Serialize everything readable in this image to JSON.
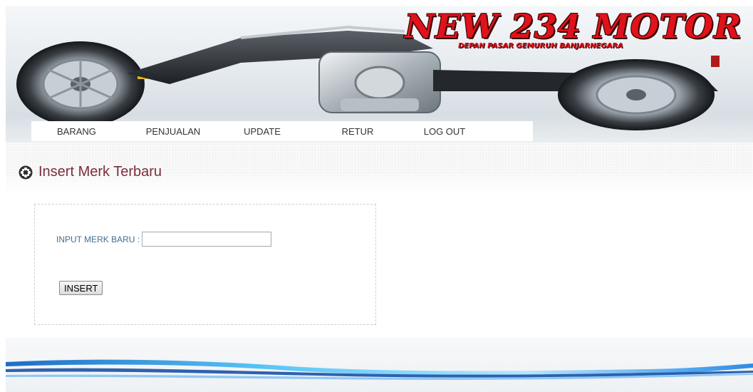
{
  "header": {
    "logo_title": "NEW 234 MOTOR",
    "logo_subtitle": "DEPAN PASAR GEMURUH BANJARNEGARA",
    "logo_color": "#e0121b"
  },
  "nav": {
    "items": [
      {
        "label": "BARANG"
      },
      {
        "label": "PENJUALAN"
      },
      {
        "label": "UPDATE"
      },
      {
        "label": "RETUR"
      },
      {
        "label": "LOG OUT"
      }
    ]
  },
  "page": {
    "heading": "Insert Merk Terbaru",
    "heading_icon": "gear-icon",
    "heading_color": "#7a2e3d"
  },
  "form": {
    "label": "INPUT MERK BARU :",
    "input_value": "",
    "submit_label": "INSERT"
  }
}
